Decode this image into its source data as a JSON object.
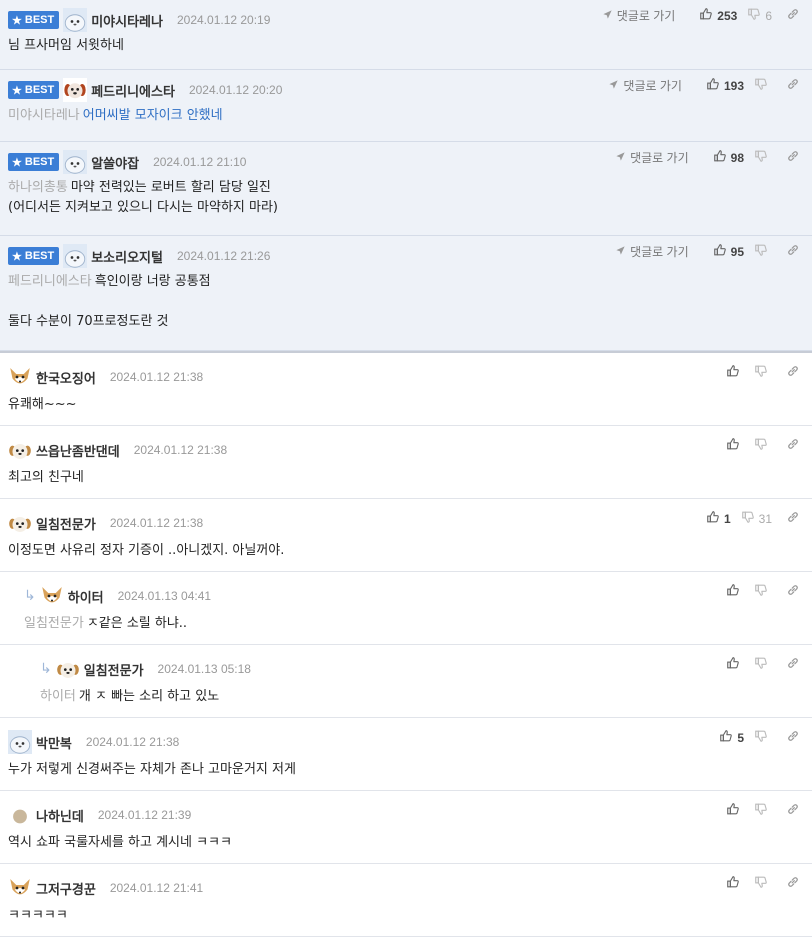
{
  "labels": {
    "best": "BEST",
    "goto": "댓글로 가기"
  },
  "best_comments": [
    {
      "nick": "미야시타레나",
      "date": "2024.01.12 20:19",
      "avatar": "seal-avatar",
      "ref": "",
      "lines": [
        "님 프사머임 서윗하네"
      ],
      "blue": false,
      "up": "253",
      "down": "6"
    },
    {
      "nick": "페드리니에스타",
      "date": "2024.01.12 20:20",
      "avatar": "dog-avatar",
      "ref": "미야시타레나",
      "lines": [
        "어머씨발 모자이크 안했네"
      ],
      "blue": true,
      "up": "193",
      "down": ""
    },
    {
      "nick": "알쓸야잡",
      "date": "2024.01.12 21:10",
      "avatar": "seal-avatar",
      "ref": "하나의총통",
      "lines": [
        "마약 전력있는 로버트 할리 담당 일진",
        "(어디서든 지켜보고 있으니 다시는 마약하지 마라)"
      ],
      "blue": false,
      "up": "98",
      "down": ""
    },
    {
      "nick": "보소리오지털",
      "date": "2024.01.12 21:26",
      "avatar": "seal-avatar",
      "ref": "페드리니에스타",
      "lines": [
        "흑인이랑 너랑 공통점",
        "",
        "둘다 수분이 70프로정도란 것"
      ],
      "blue": false,
      "up": "95",
      "down": ""
    }
  ],
  "comments": [
    {
      "nick": "한국오징어",
      "date": "2024.01.12 21:38",
      "avatar": "fox-avatar",
      "ref": "",
      "text": "유쾌해~~~",
      "up": "",
      "down": "",
      "indent": 0
    },
    {
      "nick": "쓰읍난좀반댄데",
      "date": "2024.01.12 21:38",
      "avatar": "puppy-avatar",
      "ref": "",
      "text": "최고의 친구네",
      "up": "",
      "down": "",
      "indent": 0
    },
    {
      "nick": "일침전문가",
      "date": "2024.01.12 21:38",
      "avatar": "puppy-avatar",
      "ref": "",
      "text": "이정도면 사유리 정자 기증이 ..아니겠지. 아닐꺼야.",
      "up": "1",
      "down": "31",
      "indent": 0
    },
    {
      "nick": "하이터",
      "date": "2024.01.13 04:41",
      "avatar": "fox-avatar",
      "ref": "일침전문가",
      "text": "ㅈ같은 소릴 하냐..",
      "up": "",
      "down": "",
      "indent": 1
    },
    {
      "nick": "일침전문가",
      "date": "2024.01.13 05:18",
      "avatar": "puppy-avatar",
      "ref": "하이터",
      "text": "개 ㅈ 빠는 소리 하고 있노",
      "up": "",
      "down": "",
      "indent": 2
    },
    {
      "nick": "박만복",
      "date": "2024.01.12 21:38",
      "avatar": "seal-avatar",
      "ref": "",
      "text": "누가 저렇게 신경써주는 자체가 존나 고마운거지 저게",
      "up": "5",
      "down": "",
      "indent": 0
    },
    {
      "nick": "나하닌데",
      "date": "2024.01.12 21:39",
      "avatar": "dot-avatar",
      "ref": "",
      "text": "역시 쇼파 국룰자세를 하고 계시네 ㅋㅋㅋ",
      "up": "",
      "down": "",
      "indent": 0
    },
    {
      "nick": "그저구경꾼",
      "date": "2024.01.12 21:41",
      "avatar": "fox-avatar",
      "ref": "",
      "text": "ㅋㅋㅋㅋㅋ",
      "up": "",
      "down": "",
      "indent": 0
    }
  ]
}
